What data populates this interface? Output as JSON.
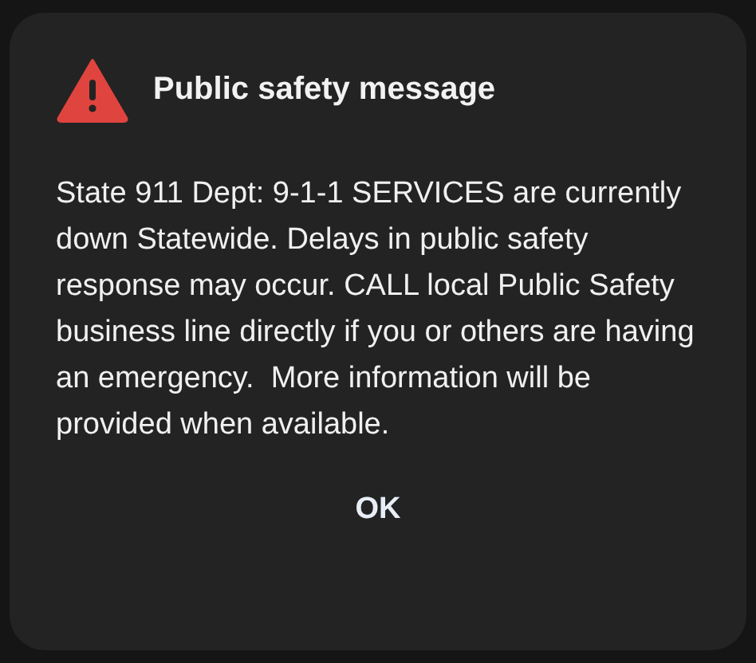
{
  "dialog": {
    "title": "Public safety message",
    "message": "State 911 Dept: 9-1-1 SERVICES are currently down Statewide. Delays in public safety response may occur. CALL local Public Safety business line directly if you or others are having an emergency.  More information will be provided when available.",
    "buttons": [
      "OK"
    ]
  }
}
